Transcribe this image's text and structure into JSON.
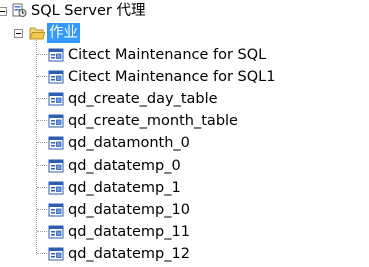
{
  "tree": {
    "agent_node": {
      "label": "SQL Server 代理",
      "icon": "sql-agent-icon",
      "expanded": true
    },
    "jobs_node": {
      "label": "作业",
      "icon": "folder-open-icon",
      "expanded": true,
      "selected": true
    },
    "jobs": [
      {
        "label": "Citect Maintenance for SQL",
        "icon": "job-icon"
      },
      {
        "label": "Citect Maintenance for SQL1",
        "icon": "job-icon"
      },
      {
        "label": "qd_create_day_table",
        "icon": "job-icon"
      },
      {
        "label": "qd_create_month_table",
        "icon": "job-icon"
      },
      {
        "label": "qd_datamonth_0",
        "icon": "job-icon"
      },
      {
        "label": "qd_datatemp_0",
        "icon": "job-icon"
      },
      {
        "label": "qd_datatemp_1",
        "icon": "job-icon"
      },
      {
        "label": "qd_datatemp_10",
        "icon": "job-icon"
      },
      {
        "label": "qd_datatemp_11",
        "icon": "job-icon"
      },
      {
        "label": "qd_datatemp_12",
        "icon": "job-icon"
      }
    ],
    "colors": {
      "selection": "#3399ff",
      "folder": "#f2c94c",
      "job_icon_blue": "#2c5fb3"
    }
  }
}
